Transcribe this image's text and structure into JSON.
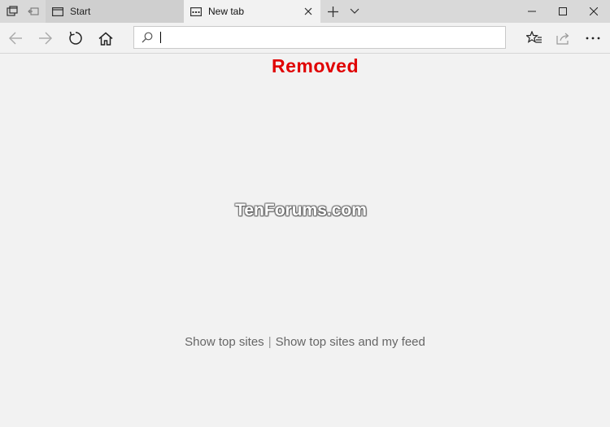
{
  "titlebar": {
    "tabs": [
      {
        "label": "Start",
        "icon": "tab-page-icon"
      },
      {
        "label": "New tab",
        "icon": "tab-page-icon",
        "close_icon": "close-icon"
      }
    ],
    "new_tab_icon": "plus-icon",
    "tab_list_icon": "chevron-down-icon",
    "window_controls": [
      "minimize-icon",
      "maximize-icon",
      "close-icon"
    ]
  },
  "navbar": {
    "back_icon": "back-arrow-icon",
    "forward_icon": "forward-arrow-icon",
    "refresh_icon": "refresh-icon",
    "home_icon": "home-icon",
    "address": {
      "value": "",
      "placeholder": ""
    },
    "favorites_icon": "favorites-star-icon",
    "share_icon": "share-icon",
    "more_icon": "more-dots-icon"
  },
  "overlay": {
    "removed": "Removed",
    "watermark": "TenForums.com"
  },
  "links": {
    "top_sites": "Show top sites",
    "separator": "|",
    "top_sites_feed": "Show top sites and my feed"
  },
  "colors": {
    "removed_text": "#e00000",
    "page_background": "#f2f2f2",
    "titlebar_background": "#d9d9d9"
  }
}
